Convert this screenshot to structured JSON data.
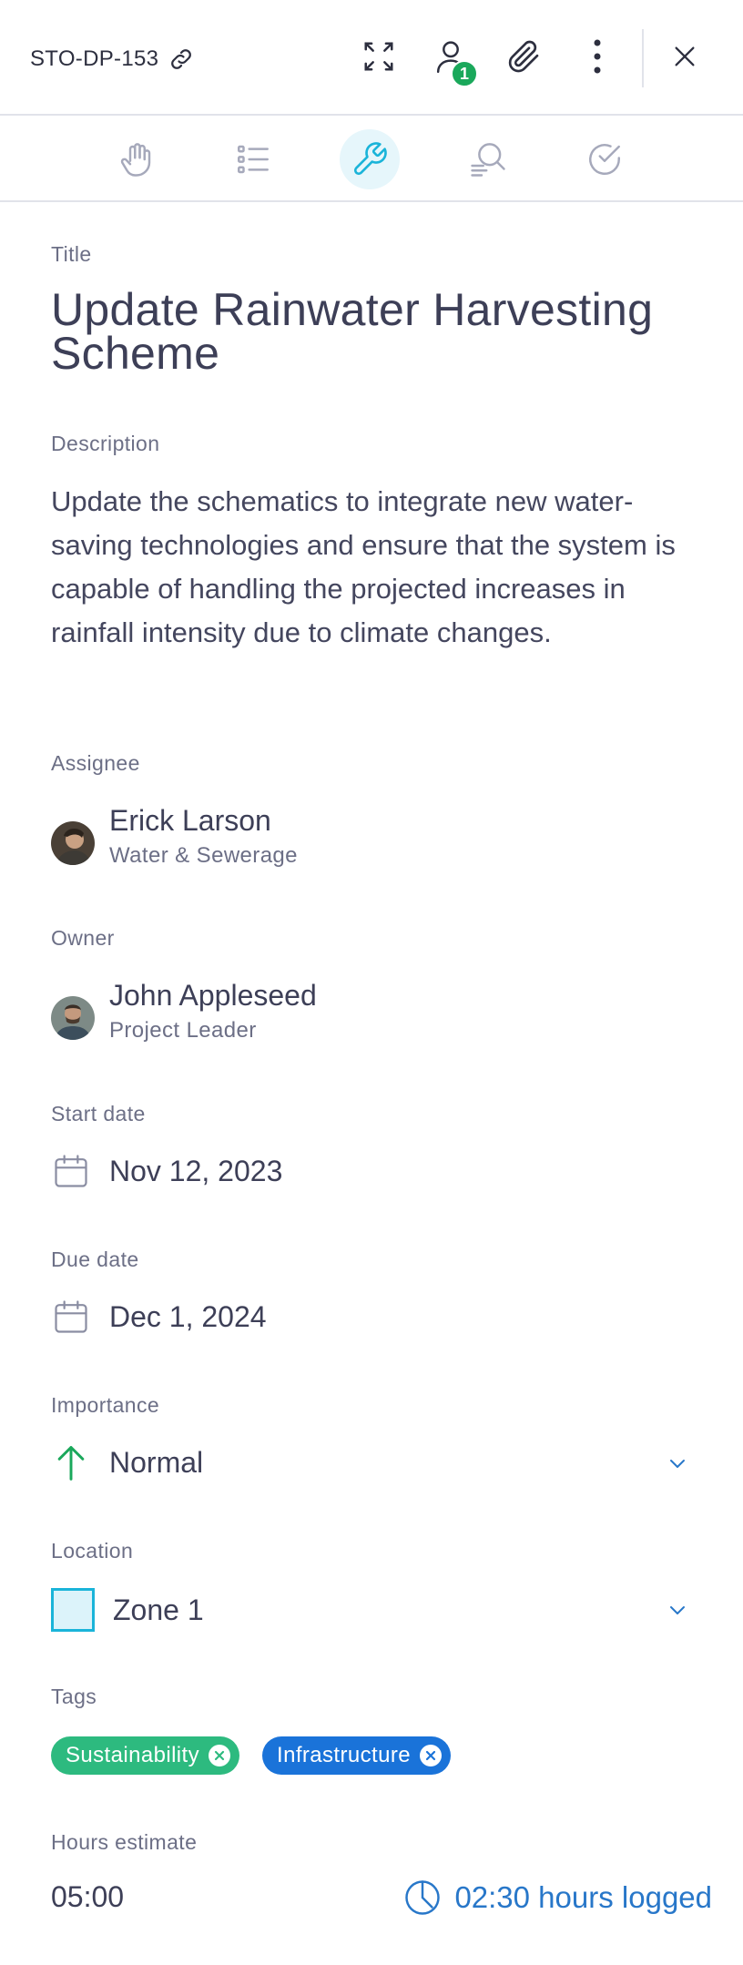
{
  "header": {
    "task_id": "STO-DP-153",
    "watchers_count": "1",
    "icons": [
      "link-icon",
      "expand-icon",
      "user-icon",
      "paperclip-icon",
      "more-vertical-icon",
      "close-icon"
    ]
  },
  "tabs": [
    {
      "name": "hand-icon",
      "active": false
    },
    {
      "name": "list-icon",
      "active": false
    },
    {
      "name": "wrench-icon",
      "active": true
    },
    {
      "name": "search-doc-icon",
      "active": false
    },
    {
      "name": "check-circle-icon",
      "active": false
    }
  ],
  "fields": {
    "title_label": "Title",
    "title": "Update Rainwater Harvesting Scheme",
    "description_label": "Description",
    "description": "Update the schematics to integrate new water-saving technologies and ensure that the system is capable of handling the projected increases in rainfall intensity due to climate changes.",
    "assignee_label": "Assignee",
    "assignee": {
      "name": "Erick Larson",
      "role": "Water & Sewerage"
    },
    "owner_label": "Owner",
    "owner": {
      "name": "John Appleseed",
      "role": "Project Leader"
    },
    "start_label": "Start date",
    "start_date": "Nov 12, 2023",
    "due_label": "Due date",
    "due_date": "Dec 1, 2024",
    "importance_label": "Importance",
    "importance": "Normal",
    "location_label": "Location",
    "location": "Zone 1",
    "tags_label": "Tags",
    "tags": [
      {
        "label": "Sustainability",
        "color": "#2dba7f"
      },
      {
        "label": "Infrastructure",
        "color": "#1a73d9"
      }
    ],
    "hours_label": "Hours estimate",
    "hours_estimate": "05:00",
    "hours_logged": "02:30 hours logged"
  },
  "colors": {
    "accent": "#1ab4d9",
    "importance_arrow": "#1aa85b",
    "link": "#2877c9"
  }
}
